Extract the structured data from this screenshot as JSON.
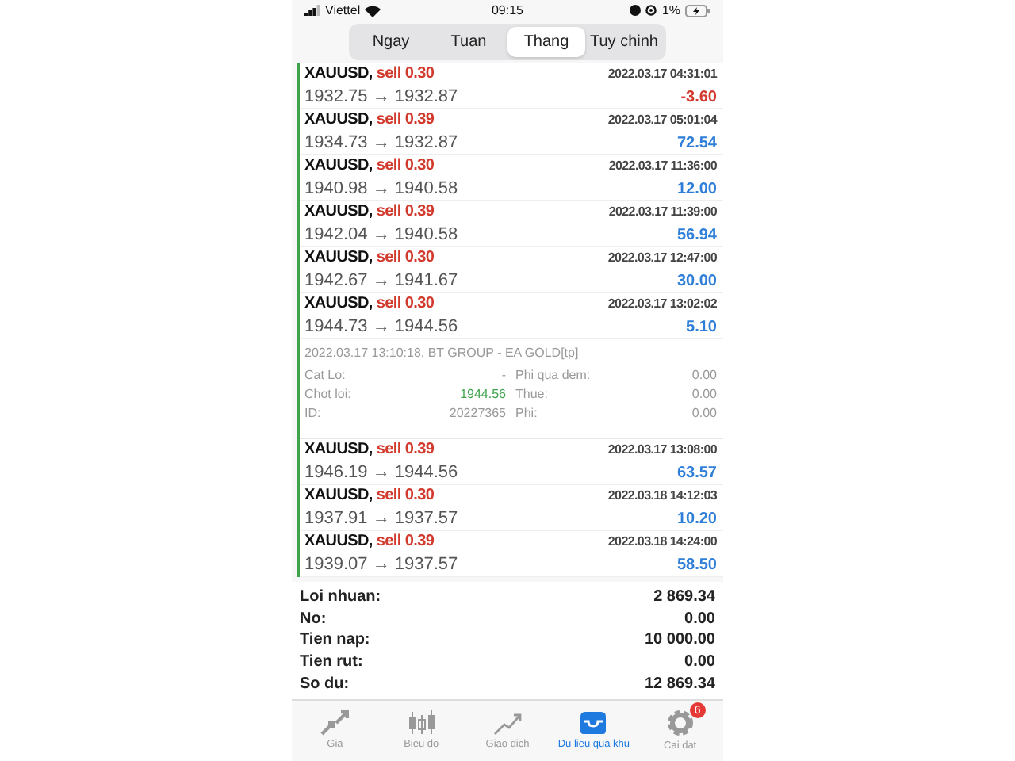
{
  "status_bar": {
    "carrier": "Viettel",
    "time": "09:15",
    "battery": "1%"
  },
  "tabs": [
    {
      "label": "Ngay",
      "selected": false
    },
    {
      "label": "Tuan",
      "selected": false
    },
    {
      "label": "Thang",
      "selected": true
    },
    {
      "label": "Tuy chinh",
      "selected": false
    }
  ],
  "trades": [
    {
      "symbol": "XAUUSD,",
      "order": "sell 0.30",
      "time": "2022.03.17 04:31:01",
      "prices": "1932.75 → 1932.87",
      "profit": "-3.60",
      "loss": true
    },
    {
      "symbol": "XAUUSD,",
      "order": "sell 0.39",
      "time": "2022.03.17 05:01:04",
      "prices": "1934.73 → 1932.87",
      "profit": "72.54",
      "loss": false
    },
    {
      "symbol": "XAUUSD,",
      "order": "sell 0.30",
      "time": "2022.03.17 11:36:00",
      "prices": "1940.98 → 1940.58",
      "profit": "12.00",
      "loss": false
    },
    {
      "symbol": "XAUUSD,",
      "order": "sell 0.39",
      "time": "2022.03.17 11:39:00",
      "prices": "1942.04 → 1940.58",
      "profit": "56.94",
      "loss": false
    },
    {
      "symbol": "XAUUSD,",
      "order": "sell 0.30",
      "time": "2022.03.17 12:47:00",
      "prices": "1942.67 → 1941.67",
      "profit": "30.00",
      "loss": false
    },
    {
      "symbol": "XAUUSD,",
      "order": "sell 0.30",
      "time": "2022.03.17 13:02:02",
      "prices": "1944.73 → 1944.56",
      "profit": "5.10",
      "loss": false,
      "detail": {
        "header": "2022.03.17 13:10:18, BT GROUP - EA GOLD[tp]",
        "columns": [
          [
            {
              "label": "Cat Lo:",
              "value": "-",
              "highlight": false
            },
            {
              "label": "Chot loi:",
              "value": "1944.56",
              "highlight": true
            },
            {
              "label": "ID:",
              "value": "20227365",
              "highlight": false
            }
          ],
          [
            {
              "label": "Phi qua dem:",
              "value": "0.00",
              "highlight": false
            },
            {
              "label": "Thue:",
              "value": "0.00",
              "highlight": false
            },
            {
              "label": "Phi:",
              "value": "0.00",
              "highlight": false
            }
          ]
        ]
      }
    },
    {
      "symbol": "XAUUSD,",
      "order": "sell 0.39",
      "time": "2022.03.17 13:08:00",
      "prices": "1946.19 → 1944.56",
      "profit": "63.57",
      "loss": false
    },
    {
      "symbol": "XAUUSD,",
      "order": "sell 0.30",
      "time": "2022.03.18 14:12:03",
      "prices": "1937.91 → 1937.57",
      "profit": "10.20",
      "loss": false
    },
    {
      "symbol": "XAUUSD,",
      "order": "sell 0.39",
      "time": "2022.03.18 14:24:00",
      "prices": "1939.07 → 1937.57",
      "profit": "58.50",
      "loss": false
    }
  ],
  "summary": [
    {
      "label": "Loi nhuan:",
      "value": "2 869.34"
    },
    {
      "label": "No:",
      "value": "0.00"
    },
    {
      "label": "Tien nap:",
      "value": "10 000.00"
    },
    {
      "label": "Tien rut:",
      "value": "0.00"
    },
    {
      "label": "So du:",
      "value": "12 869.34"
    }
  ],
  "nav": [
    {
      "kind": "quotes",
      "label": "Gia",
      "selected": false
    },
    {
      "kind": "chart",
      "label": "Bieu do",
      "selected": false
    },
    {
      "kind": "trade",
      "label": "Giao dich",
      "selected": false
    },
    {
      "kind": "history",
      "label": "Du lieu qua khu",
      "selected": true
    },
    {
      "kind": "settings",
      "label": "Cai dat",
      "selected": false,
      "badge": "6"
    }
  ]
}
